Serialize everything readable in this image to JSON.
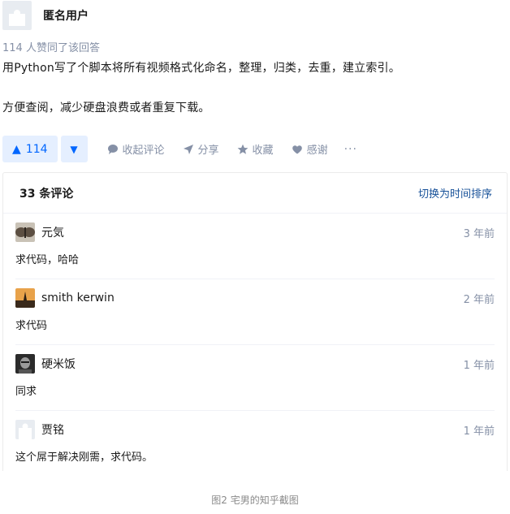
{
  "answer": {
    "author_name": "匿名用户",
    "likes_text": "114 人赞同了该回答",
    "paragraphs": [
      "用Python写了个脚本将所有视频格式化命名，整理，归类，去重，建立索引。",
      "方便查阅，减少硬盘浪费或者重复下载。"
    ]
  },
  "actions": {
    "vote_up_count": "114",
    "collapse_comments": "收起评论",
    "share": "分享",
    "favorite": "收藏",
    "thanks": "感谢",
    "more": "···"
  },
  "comments": {
    "count_label": "33 条评论",
    "sort_label": "切换为时间排序",
    "items": [
      {
        "name": "元気",
        "time": "3 年前",
        "text": "求代码，哈哈"
      },
      {
        "name": "smith kerwin",
        "time": "2 年前",
        "text": "求代码"
      },
      {
        "name": "硬米饭",
        "time": "1 年前",
        "text": "同求"
      },
      {
        "name": "贾铭",
        "time": "1 年前",
        "text": "这个屌于解决刚需，求代码。"
      }
    ]
  },
  "caption": "图2 宅男的知乎截图",
  "colors": {
    "accent": "#0066ff",
    "accent_bg": "#e5efff",
    "muted": "#8590a6",
    "link": "#175199"
  }
}
